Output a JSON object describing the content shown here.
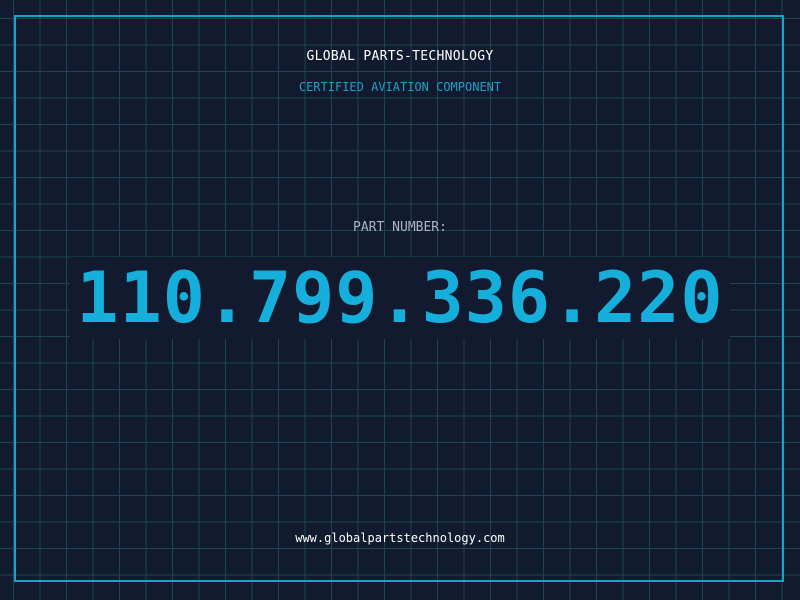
{
  "header": {
    "company": "GLOBAL PARTS-TECHNOLOGY",
    "tagline": "CERTIFIED AVIATION COMPONENT"
  },
  "part": {
    "label": "PART NUMBER:",
    "number": "110.799.336.220"
  },
  "footer": {
    "url": "www.globalpartstechnology.com"
  },
  "colors": {
    "background": "#111a2e",
    "grid": "#1d4552",
    "accent": "#1aa3c7",
    "part_number": "#16aedb",
    "label": "#a9b6c6",
    "text": "#ffffff"
  }
}
